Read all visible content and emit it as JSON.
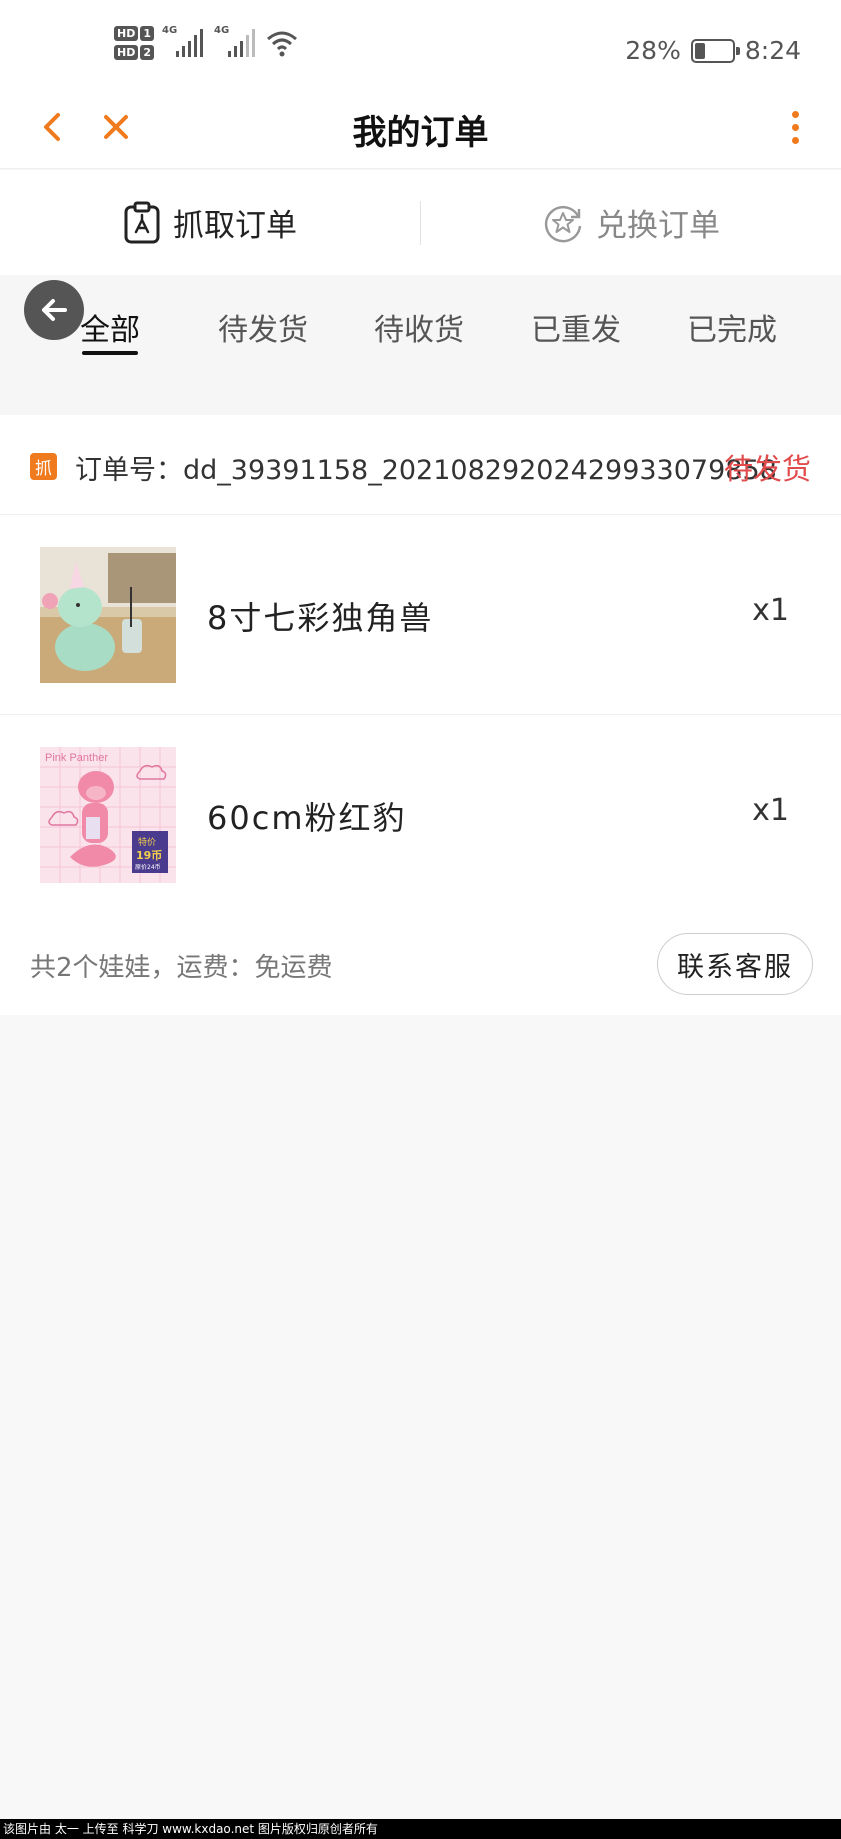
{
  "status_bar": {
    "sim1": "HD",
    "sim1_index": "1",
    "sim2": "HD",
    "sim2_index": "2",
    "net1": "4G",
    "net2": "4G",
    "battery_percent": "28%",
    "battery_level": 0.28,
    "time": "8:24",
    "icons": [
      "signal-icon",
      "wifi-icon",
      "battery-icon"
    ]
  },
  "header": {
    "title": "我的订单",
    "icons": [
      "back-arrow-icon",
      "close-icon",
      "more-vertical-icon"
    ],
    "accent_color": "#f07a1e"
  },
  "order_types": [
    {
      "label": "抓取订单",
      "icon": "clipboard-claw-icon",
      "active": true
    },
    {
      "label": "兑换订单",
      "icon": "star-refresh-icon",
      "active": false
    }
  ],
  "tabs": [
    {
      "label": "全部",
      "active": true
    },
    {
      "label": "待发货",
      "active": false
    },
    {
      "label": "待收货",
      "active": false
    },
    {
      "label": "已重发",
      "active": false
    },
    {
      "label": "已完成",
      "active": false
    }
  ],
  "order": {
    "badge": "抓",
    "number": "订单号：dd_39391158_20210829202429933079858",
    "status": "待发货",
    "status_color": "#e24b4b",
    "items": [
      {
        "name": "8寸七彩独角兽",
        "qty": "x1"
      },
      {
        "name": "60cm粉红豹",
        "qty": "x1",
        "thumb_text": "Pink Panther",
        "thumb_price": "19币",
        "thumb_price_label": "特价",
        "thumb_price_sub": "原价24币"
      }
    ],
    "summary": "共2个娃娃，运费：免运费",
    "contact_label": "联系客服"
  },
  "watermark": "该图片由 太一 上传至 科学刀 www.kxdao.net 图片版权归原创者所有"
}
